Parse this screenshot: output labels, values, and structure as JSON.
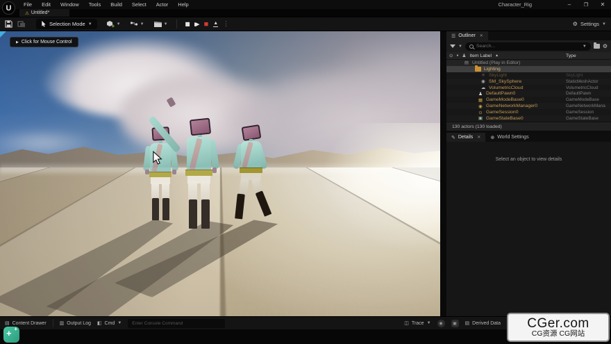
{
  "titlebar": {
    "menus": [
      "File",
      "Edit",
      "Window",
      "Tools",
      "Build",
      "Select",
      "Actor",
      "Help"
    ],
    "app_title": "Character_Rig",
    "window_controls": [
      "minimize",
      "maximize",
      "close"
    ],
    "tab_label": "Untitled*"
  },
  "toolbar": {
    "selection_mode_label": "Selection Mode",
    "play_controls": [
      "pause",
      "frame-skip",
      "stop",
      "eject",
      "more"
    ],
    "settings_label": "Settings"
  },
  "viewport": {
    "mouse_control_label": "Click for Mouse Control"
  },
  "outliner": {
    "tab_label": "Outliner",
    "search_placeholder": "Search...",
    "item_label_column": "Item Label",
    "type_column": "Type",
    "rows": [
      {
        "icon": "level-icon",
        "label": "Untitled (Play in Editor)",
        "type": "",
        "state": "world",
        "indent": "1"
      },
      {
        "icon": "folder-icon",
        "label": "Lighting",
        "type": "",
        "state": "selected",
        "indent": "2"
      },
      {
        "icon": "skylight-icon",
        "label": "SkyLight",
        "type": "SkyLight",
        "state": "dim",
        "indent": "3"
      },
      {
        "icon": "skysphere-icon",
        "label": "SM_SkySphere",
        "type": "StaticMeshActor",
        "state": "",
        "indent": "3"
      },
      {
        "icon": "cloud-icon",
        "label": "VolumetricCloud",
        "type": "VolumetricCloud",
        "state": "",
        "indent": "3"
      },
      {
        "icon": "pawn-icon",
        "label": "DefaultPawn0",
        "type": "DefaultPawn",
        "state": "",
        "indent": "4"
      },
      {
        "icon": "gamemode-icon",
        "label": "GameModeBase0",
        "type": "GameModeBase",
        "state": "",
        "indent": "4"
      },
      {
        "icon": "network-icon",
        "label": "GameNetworkManager0",
        "type": "GameNetworkMana",
        "state": "",
        "indent": "4"
      },
      {
        "icon": "session-icon",
        "label": "GameSession0",
        "type": "GameSession",
        "state": "",
        "indent": "4"
      },
      {
        "icon": "state-icon",
        "label": "GameStateBase0",
        "type": "GameStateBase",
        "state": "",
        "indent": "4"
      }
    ],
    "footer": "130 actors (130 loaded)"
  },
  "details": {
    "tab_label": "Details",
    "world_settings_label": "World Settings",
    "empty_message": "Select an object to view details"
  },
  "statusbar": {
    "content_drawer_label": "Content Drawer",
    "output_log_label": "Output Log",
    "cmd_label": "Cmd",
    "console_placeholder": "Enter Console Command",
    "trace_label": "Trace",
    "derived_data_label": "Derived Data"
  },
  "watermark": {
    "line1": "CGer.com",
    "line2": "CG资源 CG网站"
  },
  "colors": {
    "selection_gold": "#c49a55",
    "stop_red": "#d23b2f",
    "selected_row": "#3f3f3f",
    "folder_orange": "#cf9130"
  }
}
